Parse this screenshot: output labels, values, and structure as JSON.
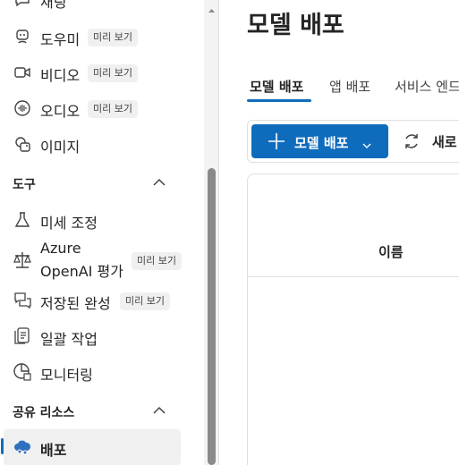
{
  "sidebar": {
    "items": [
      {
        "label": "채팅",
        "icon": "chat-icon"
      },
      {
        "label": "도우미",
        "icon": "assistant-bot-icon",
        "badge": "미리 보기"
      },
      {
        "label": "비디오",
        "icon": "video-icon",
        "badge": "미리 보기"
      },
      {
        "label": "오디오",
        "icon": "audio-icon",
        "badge": "미리 보기"
      },
      {
        "label": "이미지",
        "icon": "image-icon"
      }
    ],
    "tools_section": {
      "title": "도구",
      "items": [
        {
          "label": "미세 조정",
          "icon": "flask-icon"
        },
        {
          "label": "Azure OpenAI 평가",
          "line1": "Azure",
          "line2": "OpenAI 평가",
          "icon": "scale-icon",
          "badge": "미리 보기"
        },
        {
          "label": "저장된 완성",
          "icon": "saved-chat-icon",
          "badge": "미리 보기"
        },
        {
          "label": "일괄 작업",
          "icon": "batch-document-icon"
        },
        {
          "label": "모니터링",
          "icon": "monitor-chart-icon"
        }
      ]
    },
    "shared_section": {
      "title": "공유 리소스",
      "items": [
        {
          "label": "배포",
          "icon": "cloud-deploy-icon",
          "selected": true
        }
      ]
    }
  },
  "main": {
    "title": "모델 배포",
    "tabs": [
      {
        "label": "모델 배포",
        "active": true
      },
      {
        "label": "앱 배포"
      },
      {
        "label": "서비스 엔드포인트"
      }
    ],
    "toolbar": {
      "deploy_label": "모델 배포",
      "refresh_label": "새로 고침"
    },
    "table": {
      "columns": [
        "이름"
      ]
    }
  },
  "colors": {
    "accent": "#0f6cbd",
    "badge_bg": "#f0f0f0",
    "selected_bg": "#f0f0f0"
  }
}
